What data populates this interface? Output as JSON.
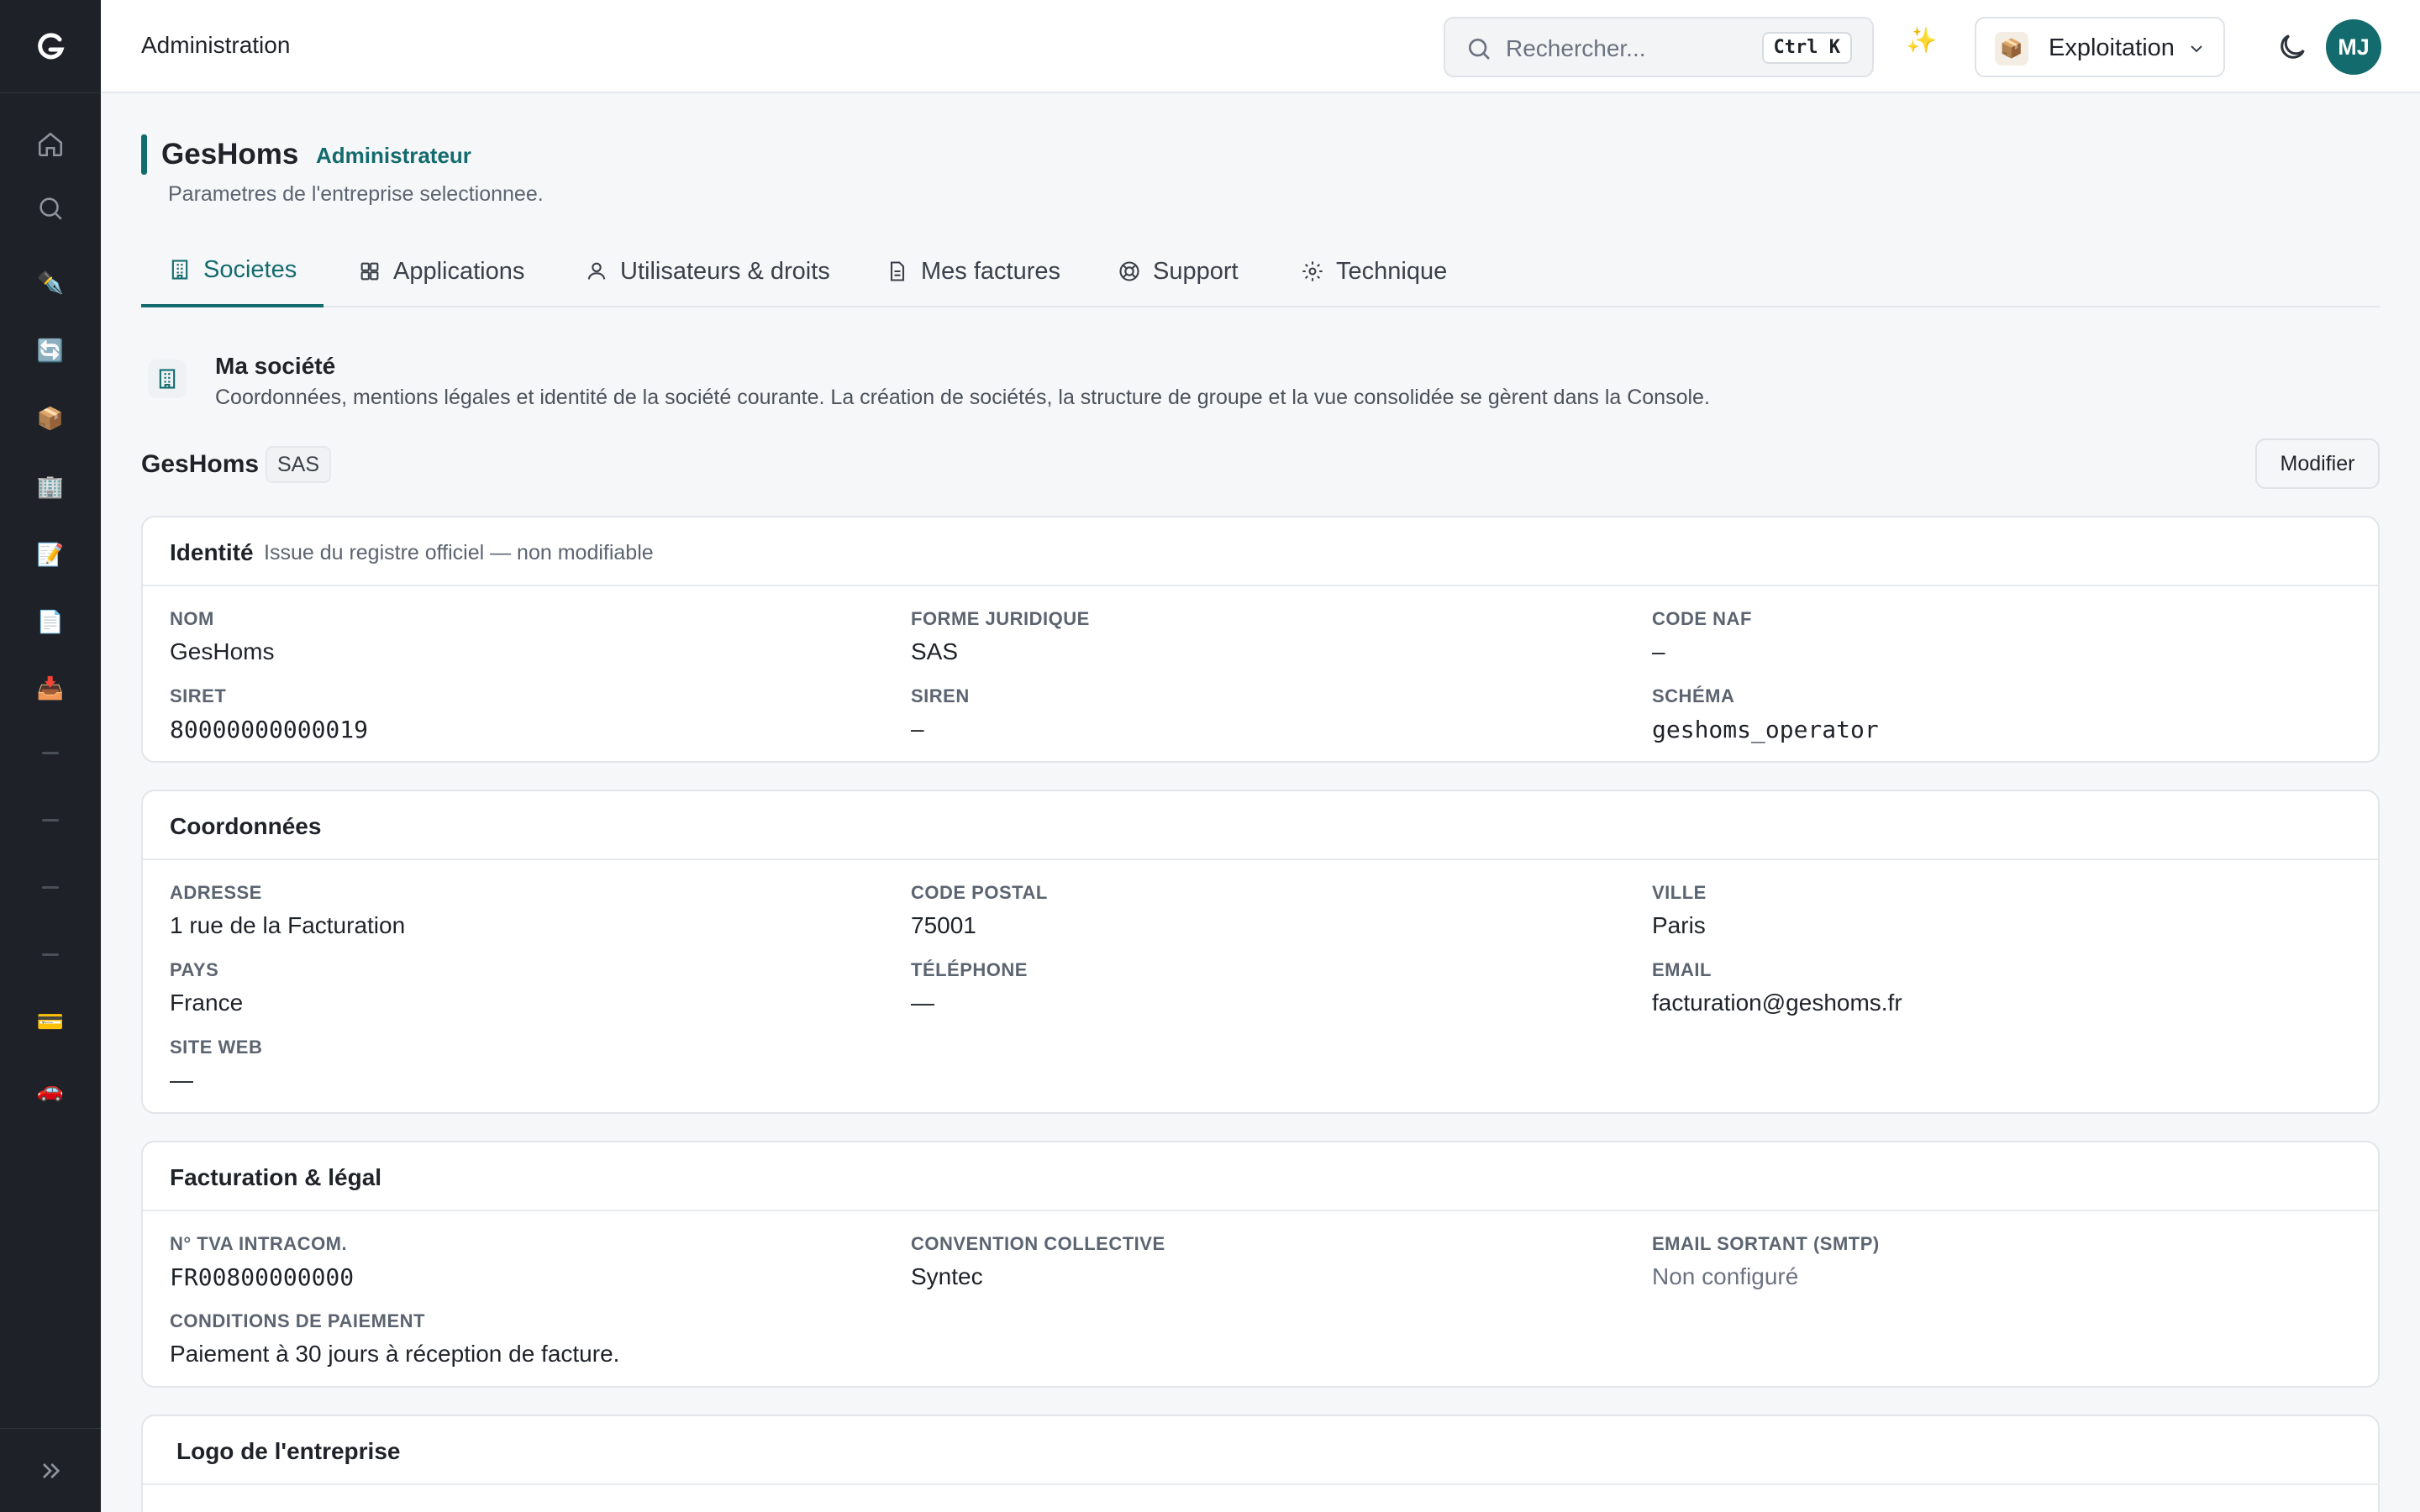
{
  "header": {
    "title": "Administration",
    "search_placeholder": "Rechercher...",
    "search_shortcut": "Ctrl K",
    "workspace": "Exploitation",
    "avatar_initials": "MJ"
  },
  "page": {
    "title": "GesHoms",
    "role": "Administrateur",
    "subtitle": "Parametres de l'entreprise selectionnee."
  },
  "tabs": [
    {
      "label": "Societes",
      "icon": "building-icon"
    },
    {
      "label": "Applications",
      "icon": "grid-icon"
    },
    {
      "label": "Utilisateurs & droits",
      "icon": "users-icon"
    },
    {
      "label": "Mes factures",
      "icon": "file-icon"
    },
    {
      "label": "Support",
      "icon": "lifebuoy-icon"
    },
    {
      "label": "Technique",
      "icon": "gear-icon"
    }
  ],
  "info": {
    "title": "Ma société",
    "description": "Coordonnées, mentions légales et identité de la société courante. La création de sociétés, la structure de groupe et la vue consolidée se gèrent dans la Console."
  },
  "company": {
    "name": "GesHoms",
    "form_badge": "SAS",
    "modify_label": "Modifier"
  },
  "identity": {
    "title": "Identité",
    "note": "Issue du registre officiel — non modifiable",
    "fields": [
      {
        "label": "Nom",
        "value": "GesHoms"
      },
      {
        "label": "Forme juridique",
        "value": "SAS"
      },
      {
        "label": "Code NAF",
        "value": "–"
      },
      {
        "label": "SIRET",
        "value": "80000000000019"
      },
      {
        "label": "SIREN",
        "value": "–"
      },
      {
        "label": "Schéma",
        "value": "geshoms_operator"
      }
    ]
  },
  "contact": {
    "title": "Coordonnées",
    "fields": [
      {
        "label": "Adresse",
        "value": "1 rue de la Facturation"
      },
      {
        "label": "Code postal",
        "value": "75001"
      },
      {
        "label": "Ville",
        "value": "Paris"
      },
      {
        "label": "Pays",
        "value": "France"
      },
      {
        "label": "Téléphone",
        "value": "—"
      },
      {
        "label": "Email",
        "value": "facturation@geshoms.fr"
      },
      {
        "label": "Site web",
        "value": "—"
      }
    ]
  },
  "billing": {
    "title": "Facturation & légal",
    "fields": [
      {
        "label": "N° TVA intracom.",
        "value": "FR00800000000"
      },
      {
        "label": "Convention collective",
        "value": "Syntec"
      },
      {
        "label": "Email sortant (SMTP)",
        "value": "Non configuré"
      },
      {
        "label": "Conditions de paiement",
        "value": "Paiement à 30 jours à réception de facture."
      }
    ]
  },
  "logo_card": {
    "title": "Logo de l'entreprise"
  },
  "colors": {
    "accent": "#146b6e",
    "sidebar": "#1e2228",
    "background": "#f6f7f9"
  }
}
